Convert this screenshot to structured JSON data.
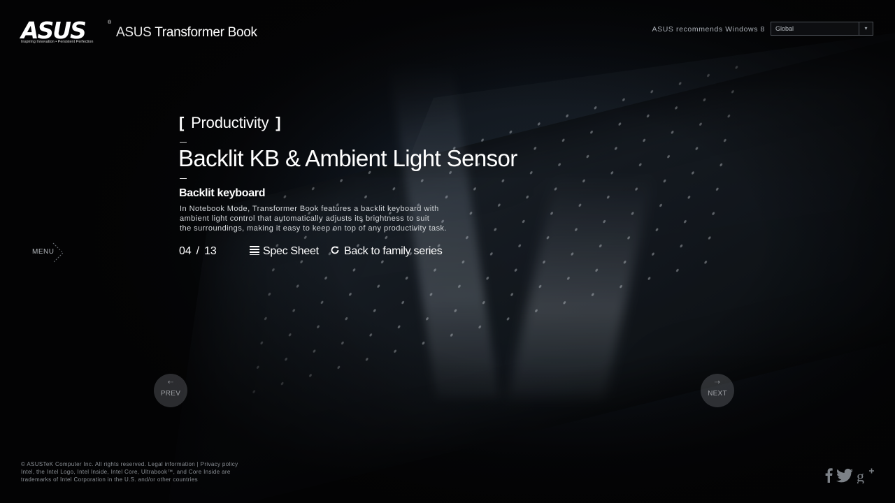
{
  "header": {
    "logo_text": "ASUS",
    "logo_tagline": "Inspiring Innovation • Persistent Perfection",
    "product_brand": "ASUS",
    "product_name": "Transformer Book",
    "recommend_text": "ASUS recommends Windows 8",
    "region_select": {
      "value": "Global"
    }
  },
  "feature": {
    "category_open": "[",
    "category": "Productivity",
    "category_close": "]",
    "title": "Backlit KB & Ambient Light Sensor",
    "subtitle": "Backlit keyboard",
    "description_lines": [
      "In Notebook Mode, Transformer Book features a backlit keyboard with",
      "ambient light control that automatically adjusts its brightness to suit",
      "the surroundings, making it easy to keep on top of any productivity task."
    ]
  },
  "pager": {
    "current": "04",
    "separator": "/",
    "total": "13"
  },
  "links": {
    "spec_sheet": "Spec Sheet",
    "back": "Back to family series"
  },
  "menu": {
    "label": "MENU"
  },
  "nav": {
    "prev": "PREV",
    "next": "NEXT"
  },
  "footer": {
    "copyright": "© ASUSTeK Computer Inc. All rights reserved.",
    "legal": "Legal information",
    "divider": "|",
    "privacy": "Privacy policy",
    "trademark_line1": "Intel, the Intel Logo, Intel Inside, Intel Core, Ultrabook™, and Core Inside are",
    "trademark_line2": "trademarks of Intel Corporation in the U.S. and/or other countries"
  },
  "social": [
    "facebook-icon",
    "twitter-icon",
    "google-plus-icon"
  ],
  "colors": {
    "background": "#050608",
    "text": "#ffffff",
    "muted": "#8a8f95"
  }
}
